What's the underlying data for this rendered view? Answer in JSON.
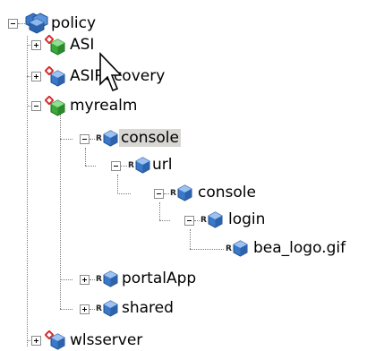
{
  "tree": {
    "nodes": [
      {
        "id": "policy",
        "label": "policy",
        "depth": 0,
        "expanded": true,
        "kind": "root-group"
      },
      {
        "id": "asi",
        "label": "ASI",
        "depth": 1,
        "expanded": false,
        "kind": "realm-green"
      },
      {
        "id": "asirecovery",
        "label": "ASIRecovery",
        "depth": 1,
        "expanded": false,
        "kind": "realm-blue"
      },
      {
        "id": "myrealm",
        "label": "myrealm",
        "depth": 1,
        "expanded": true,
        "kind": "realm-green"
      },
      {
        "id": "console",
        "label": "console",
        "depth": 2,
        "expanded": true,
        "kind": "resource",
        "selected": true
      },
      {
        "id": "url",
        "label": "url",
        "depth": 3,
        "expanded": true,
        "kind": "resource"
      },
      {
        "id": "console2",
        "label": "console",
        "depth": 4,
        "expanded": true,
        "kind": "resource"
      },
      {
        "id": "login",
        "label": "login",
        "depth": 5,
        "expanded": true,
        "kind": "resource"
      },
      {
        "id": "bealogo",
        "label": "bea_logo.gif",
        "depth": 6,
        "expanded": null,
        "kind": "resource"
      },
      {
        "id": "portalapp",
        "label": "portalApp",
        "depth": 2,
        "expanded": false,
        "kind": "resource"
      },
      {
        "id": "shared",
        "label": "shared",
        "depth": 2,
        "expanded": false,
        "kind": "resource"
      },
      {
        "id": "wlsserver",
        "label": "wlsserver",
        "depth": 1,
        "expanded": false,
        "kind": "realm-blue"
      }
    ],
    "resource_badge": "R"
  },
  "colors": {
    "connector": "#7a7a7a",
    "selection": "#d8d6d2",
    "cube_blue": "#3b78c8",
    "cube_green": "#3aa83a",
    "pin_red": "#d62d2d"
  },
  "icons": {
    "root": "policy-group-icon",
    "realm": "realm-cube-icon",
    "resource": "resource-cube-icon",
    "cursor": "mouse-pointer-icon"
  }
}
